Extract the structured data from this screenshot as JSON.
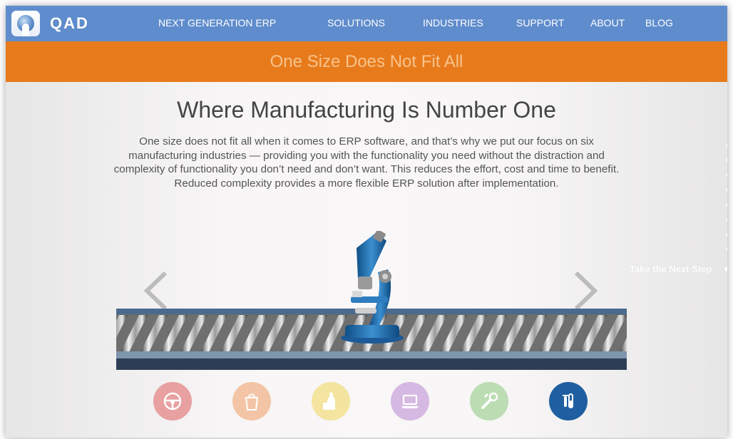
{
  "brand": {
    "name": "QAD",
    "logo_icon": "qad-logo-icon"
  },
  "nav": {
    "items": [
      {
        "label": "NEXT GENERATION ERP"
      },
      {
        "label": "SOLUTIONS"
      },
      {
        "label": "INDUSTRIES"
      },
      {
        "label": "SUPPORT"
      },
      {
        "label": "ABOUT"
      },
      {
        "label": "BLOG"
      }
    ]
  },
  "banner": {
    "text": "One Size Does Not Fit All"
  },
  "hero": {
    "headline": "Where Manufacturing Is Number One",
    "body": "One size does not fit all when it comes to ERP software, and that’s why we put our focus on six manufacturing industries — providing you with the functionality you need without the distraction and complexity of functionality you don’t need and don’t want. This reduces the effort, cost and time to benefit. Reduced complexity provides a more flexible ERP solution after implementation."
  },
  "carousel": {
    "prev_icon": "chevron-left-icon",
    "next_icon": "chevron-right-icon",
    "current_image": "microscope-on-conveyor"
  },
  "industries": [
    {
      "name": "automotive",
      "icon": "steering-wheel-icon",
      "color": "#e8a0a0",
      "active": false
    },
    {
      "name": "consumer-products",
      "icon": "shopping-bag-icon",
      "color": "#f3c5a6",
      "active": false
    },
    {
      "name": "food-and-beverage",
      "icon": "bottle-icon",
      "color": "#f3e4a0",
      "active": false
    },
    {
      "name": "high-tech",
      "icon": "laptop-icon",
      "color": "#d5b9e2",
      "active": false
    },
    {
      "name": "industrial",
      "icon": "wrench-icon",
      "color": "#bcdcb3",
      "active": false
    },
    {
      "name": "life-sciences",
      "icon": "test-tubes-icon",
      "color": "#1f5fa1",
      "active": true
    }
  ],
  "rail": {
    "next_step_label": "Take the Next Step"
  },
  "colors": {
    "header": "#5f8ccc",
    "banner": "#e77b1c",
    "banner_text": "#f8c38b"
  }
}
